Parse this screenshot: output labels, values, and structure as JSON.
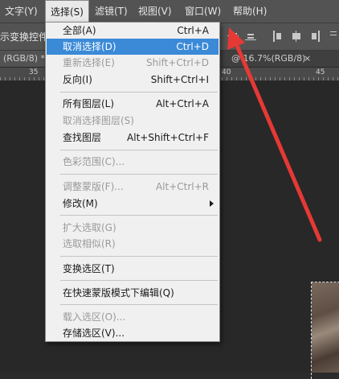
{
  "menubar": {
    "items": [
      {
        "label": "文字(Y)"
      },
      {
        "label": "选择(S)"
      },
      {
        "label": "滤镜(T)"
      },
      {
        "label": "视图(V)"
      },
      {
        "label": "窗口(W)"
      },
      {
        "label": "帮助(H)"
      }
    ]
  },
  "options_bar": {
    "label": "示变换控件"
  },
  "tabs": [
    {
      "label": "(RGB/8) *"
    },
    {
      "label": "@ 16.7%(RGB/8)"
    }
  ],
  "ruler": {
    "labels": [
      "35",
      "40",
      "45"
    ]
  },
  "select_menu": {
    "items": [
      {
        "label": "全部(A)",
        "shortcut": "Ctrl+A"
      },
      {
        "label": "取消选择(D)",
        "shortcut": "Ctrl+D"
      },
      {
        "label": "重新选择(E)",
        "shortcut": "Shift+Ctrl+D"
      },
      {
        "label": "反向(I)",
        "shortcut": "Shift+Ctrl+I"
      },
      {
        "label": "所有图层(L)",
        "shortcut": "Alt+Ctrl+A"
      },
      {
        "label": "取消选择图层(S)",
        "shortcut": ""
      },
      {
        "label": "查找图层",
        "shortcut": "Alt+Shift+Ctrl+F"
      },
      {
        "label": "色彩范围(C)...",
        "shortcut": ""
      },
      {
        "label": "调整蒙版(F)...",
        "shortcut": "Alt+Ctrl+R"
      },
      {
        "label": "修改(M)",
        "shortcut": ""
      },
      {
        "label": "扩大选取(G)",
        "shortcut": ""
      },
      {
        "label": "选取相似(R)",
        "shortcut": ""
      },
      {
        "label": "变换选区(T)",
        "shortcut": ""
      },
      {
        "label": "在快速蒙版模式下编辑(Q)",
        "shortcut": ""
      },
      {
        "label": "载入选区(O)...",
        "shortcut": ""
      },
      {
        "label": "存储选区(V)...",
        "shortcut": ""
      }
    ]
  },
  "colors": {
    "highlight": "#3b8ad8",
    "annotation_arrow": "#e53935"
  }
}
